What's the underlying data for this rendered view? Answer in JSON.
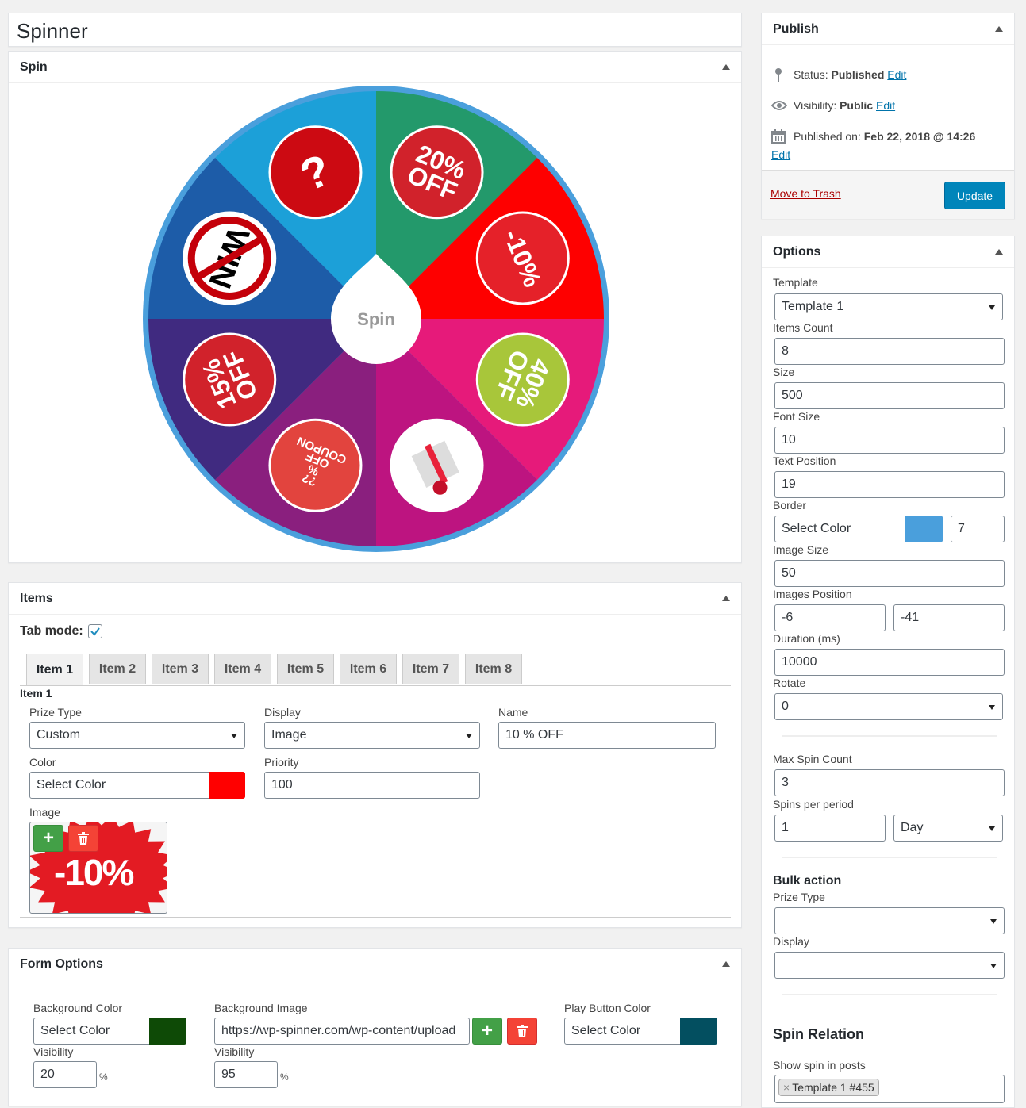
{
  "title": "Spinner",
  "spin_box": {
    "heading": "Spin",
    "wheel": {
      "center_label": "Spin",
      "border_color": "#4a9fdc",
      "segments": [
        {
          "color": "#1ca0d8",
          "badge": "?",
          "badge_bg": "#cc0a12"
        },
        {
          "color": "#23996b",
          "badge": "20% OFF",
          "badge_bg": "#d1222b"
        },
        {
          "color": "#fe0000",
          "badge": "-10%",
          "badge_bg": "#e52129"
        },
        {
          "color": "#e61a7a",
          "badge": "40% OFF",
          "badge_bg": "#a8c63a"
        },
        {
          "color": "#bd1480",
          "badge": "gift",
          "badge_bg": "#ffffff"
        },
        {
          "color": "#8a1f7e",
          "badge": "?? % OFF COUPON",
          "badge_bg": "#e2443e"
        },
        {
          "color": "#402a80",
          "badge": "15% OFF",
          "badge_bg": "#d1222b"
        },
        {
          "color": "#1d5ca8",
          "badge": "WIN",
          "badge_bg": "#ffffff"
        }
      ]
    }
  },
  "items_box": {
    "heading": "Items",
    "tab_mode_label": "Tab mode:",
    "tab_mode_checked": true,
    "tabs": [
      "Item 1",
      "Item 2",
      "Item 3",
      "Item 4",
      "Item 5",
      "Item 6",
      "Item 7",
      "Item 8"
    ],
    "active_tab": 0,
    "item_title": "Item 1",
    "prize_type_label": "Prize Type",
    "prize_type_value": "Custom",
    "display_label": "Display",
    "display_value": "Image",
    "name_label": "Name",
    "name_value": "10 % OFF",
    "color_label": "Color",
    "color_placeholder": "Select Color",
    "color_value": "#ff0000",
    "priority_label": "Priority",
    "priority_value": "100",
    "image_label": "Image",
    "image_text": "-10%",
    "add_icon": "+",
    "delete_icon": "trash-icon"
  },
  "form_options": {
    "heading": "Form Options",
    "bg_color_label": "Background Color",
    "bg_color_placeholder": "Select Color",
    "bg_color_value": "#0e4a06",
    "bg_visibility_label": "Visibility",
    "bg_visibility_value": "20",
    "bg_image_label": "Background Image",
    "bg_image_value": "https://wp-spinner.com/wp-content/upload",
    "bg_image_visibility_label": "Visibility",
    "bg_image_visibility_value": "95",
    "play_color_label": "Play Button Color",
    "play_color_placeholder": "Select Color",
    "play_color_value": "#034f60",
    "percent": "%",
    "add_icon": "+"
  },
  "publish": {
    "heading": "Publish",
    "status_label": "Status:",
    "status_value": "Published",
    "visibility_label": "Visibility:",
    "visibility_value": "Public",
    "published_label": "Published on:",
    "published_value": "Feb 22, 2018 @ 14:26",
    "edit": "Edit",
    "trash": "Move to Trash",
    "update": "Update"
  },
  "options": {
    "heading": "Options",
    "template_label": "Template",
    "template_value": "Template 1",
    "items_count_label": "Items Count",
    "items_count_value": "8",
    "size_label": "Size",
    "size_value": "500",
    "font_size_label": "Font Size",
    "font_size_value": "10",
    "text_position_label": "Text Position",
    "text_position_value": "19",
    "border_label": "Border",
    "border_placeholder": "Select Color",
    "border_color": "#4a9fdc",
    "border_width": "7",
    "image_size_label": "Image Size",
    "image_size_value": "50",
    "images_position_label": "Images Position",
    "images_position_x": "-6",
    "images_position_y": "-41",
    "duration_label": "Duration (ms)",
    "duration_value": "10000",
    "rotate_label": "Rotate",
    "rotate_value": "0",
    "max_spin_label": "Max Spin Count",
    "max_spin_value": "3",
    "spins_period_label": "Spins per period",
    "spins_period_value": "1",
    "period_value": "Day",
    "bulk_heading": "Bulk action",
    "bulk_prize_label": "Prize Type",
    "bulk_prize_value": "",
    "bulk_display_label": "Display",
    "bulk_display_value": "",
    "relation_heading": "Spin Relation",
    "show_in_posts_label": "Show spin in posts",
    "show_in_posts_tag": "Template 1 #455",
    "tag_remove": "×"
  }
}
